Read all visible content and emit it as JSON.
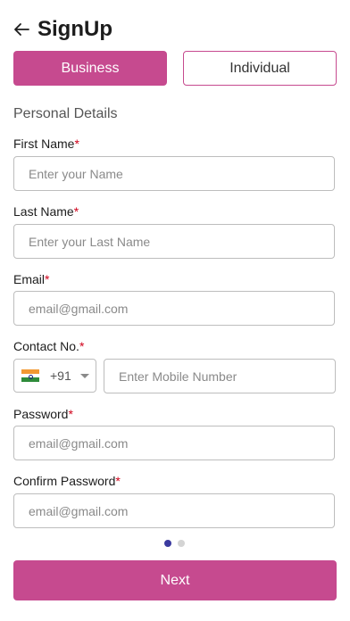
{
  "header": {
    "title": "SignUp"
  },
  "tabs": [
    {
      "label": "Business",
      "active": true
    },
    {
      "label": "Individual",
      "active": false
    }
  ],
  "section_title": "Personal Details",
  "required_marker": "*",
  "fields": {
    "first_name": {
      "label": "First Name",
      "placeholder": "Enter your Name",
      "value": ""
    },
    "last_name": {
      "label": "Last Name",
      "placeholder": "Enter your Last Name",
      "value": ""
    },
    "email": {
      "label": "Email",
      "placeholder": "email@gmail.com",
      "value": ""
    },
    "contact": {
      "label": "Contact No.",
      "country_code": "+91",
      "country_flag": "india-flag-icon",
      "placeholder": "Enter Mobile Number",
      "value": ""
    },
    "password": {
      "label": "Password",
      "placeholder": "email@gmail.com",
      "value": ""
    },
    "confirm_password": {
      "label": "Confirm Password",
      "placeholder": "email@gmail.com",
      "value": ""
    }
  },
  "pagination": {
    "current": 1,
    "total": 2
  },
  "next_button": {
    "label": "Next"
  },
  "colors": {
    "accent": "#c64a8f",
    "dot_active": "#3b3a9f",
    "required": "#d0021b"
  }
}
